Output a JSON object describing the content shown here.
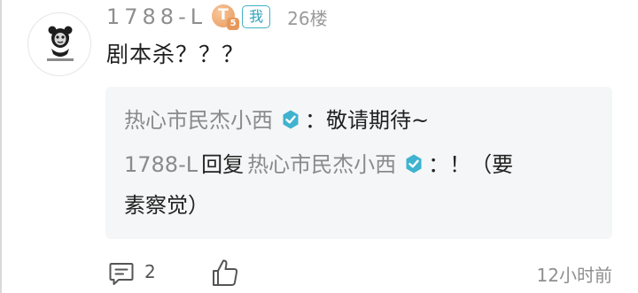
{
  "comment": {
    "username": "1788-L",
    "level": "5",
    "me_badge": "我",
    "floor": "26楼",
    "text": "剧本杀？？？",
    "avatar_icon": "panda-meme-avatar"
  },
  "replies": [
    {
      "author": "热心市民杰小西",
      "verified": true,
      "separator": "：",
      "text": "敬请期待~"
    },
    {
      "author": "1788-L",
      "action": "回复",
      "target": "热心市民杰小西",
      "target_verified": true,
      "separator": "：",
      "text": "！（要",
      "text_cont": "素察觉）"
    }
  ],
  "footer": {
    "comment_icon": "comment-icon",
    "comment_count": "2",
    "like_icon": "thumbs-up-icon",
    "timestamp": "12小时前"
  },
  "colors": {
    "verified": "#3fb3cf",
    "me_badge": "#43b0c4",
    "level_badge": "#e99a5b"
  }
}
